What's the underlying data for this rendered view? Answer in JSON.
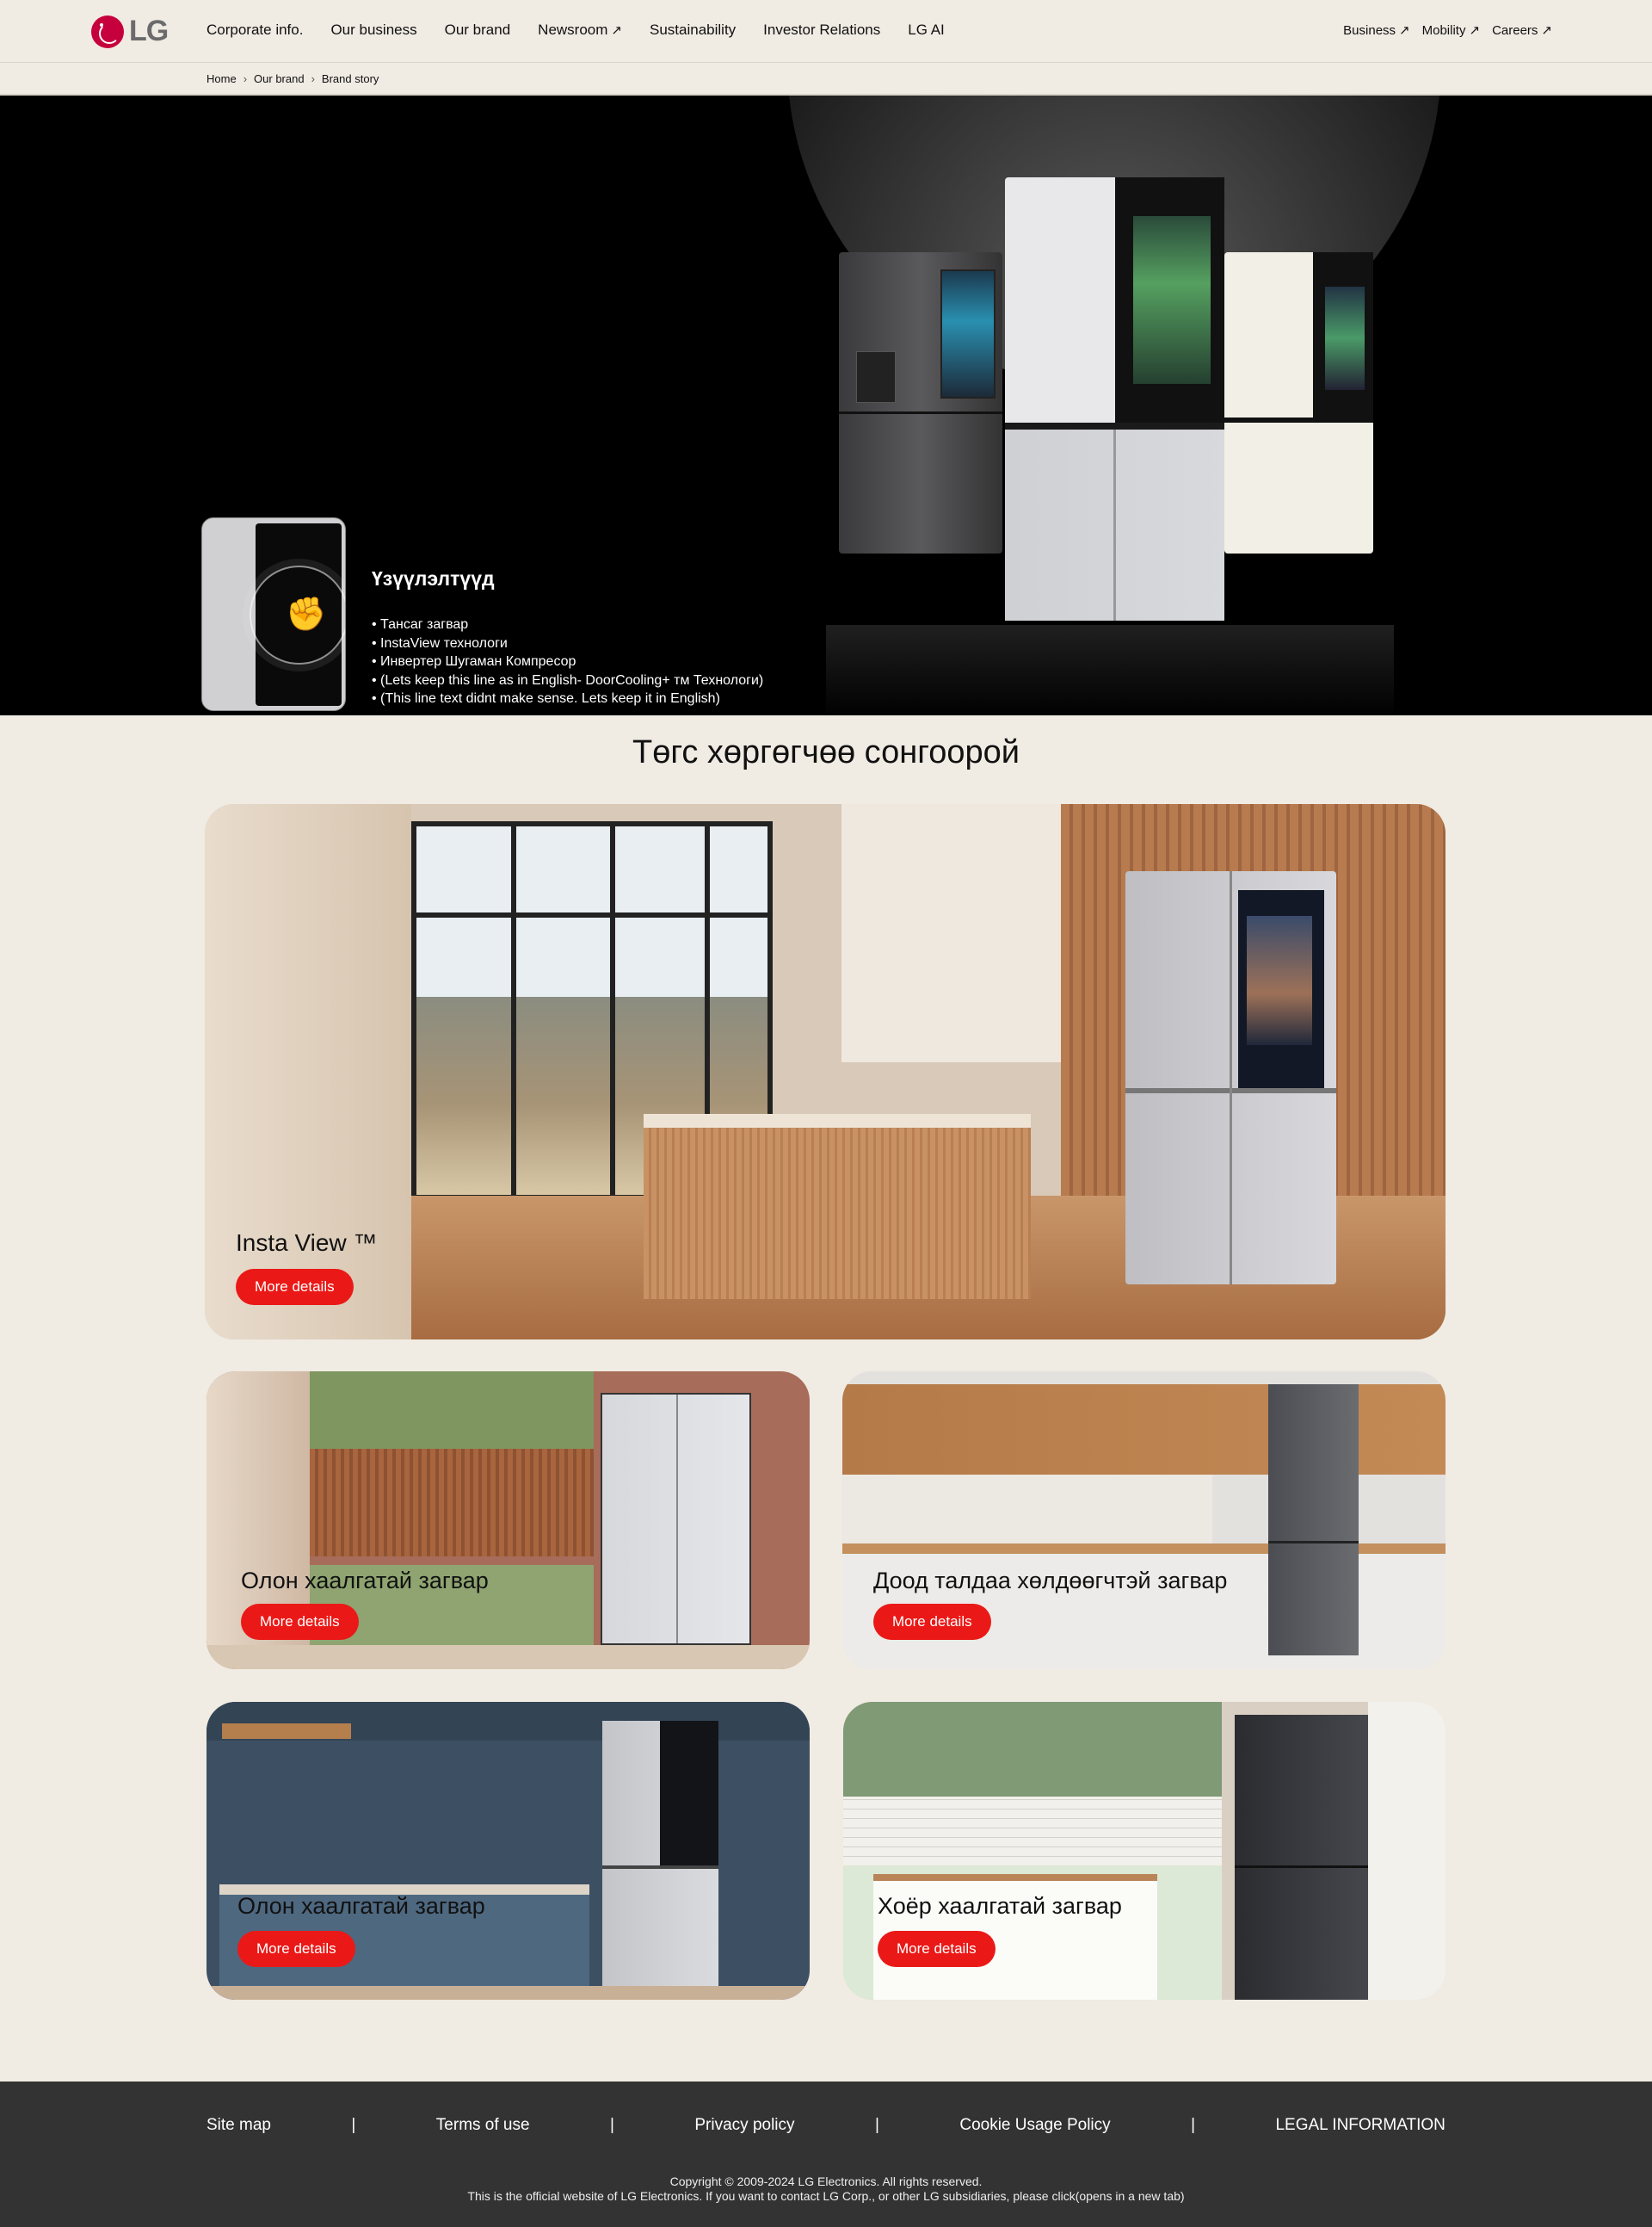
{
  "header": {
    "logo_text": "LG",
    "nav": [
      "Corporate info.",
      "Our business",
      "Our brand",
      "Newsroom",
      "Sustainability",
      "Investor Relations",
      "LG AI"
    ],
    "utility": [
      "Business",
      "Mobility",
      "Careers"
    ]
  },
  "breadcrumb": [
    "Home",
    "Our brand",
    "Brand story"
  ],
  "hero": {
    "title": "Үзүүлэлтүүд",
    "features": [
      "• Тансаг загвар",
      "• InstaView технологи",
      "• Инвертер Шугаман Компресор",
      "• (Lets keep this line as in English- DoorCooling+ тм Технологи)",
      "• (This line text didnt make sense. Lets keep it in English)"
    ]
  },
  "section": {
    "title": "Төгс хөргөгчөө сонгоорой",
    "cards": [
      {
        "label": "Insta View ™",
        "button": "More details"
      },
      {
        "label": "Олон хаалгатай загвар",
        "button": "More details"
      },
      {
        "label": "Доод талдаа хөлдөөгчтэй загвар",
        "button": "More details"
      },
      {
        "label": "Олон хаалгатай загвар",
        "button": "More details"
      },
      {
        "label": "Хоёр хаалгатай загвар",
        "button": "More details"
      }
    ]
  },
  "footer": {
    "links": [
      "Site map",
      "|",
      "Terms of use",
      "|",
      "Privacy policy",
      "|",
      "Cookie Usage Policy",
      "|",
      "LEGAL INFORMATION"
    ],
    "copyright": "Copyright © 2009-2024 LG Electronics. All rights reserved.",
    "notice": "This is the official website of LG Electronics. If you want to contact LG Corp., or other LG subsidiaries, please click(opens in a new tab)"
  },
  "colors": {
    "accent_button": "#ea1917",
    "background": "#f0ebe3",
    "footer": "#333333",
    "logo": "#c6003c"
  }
}
